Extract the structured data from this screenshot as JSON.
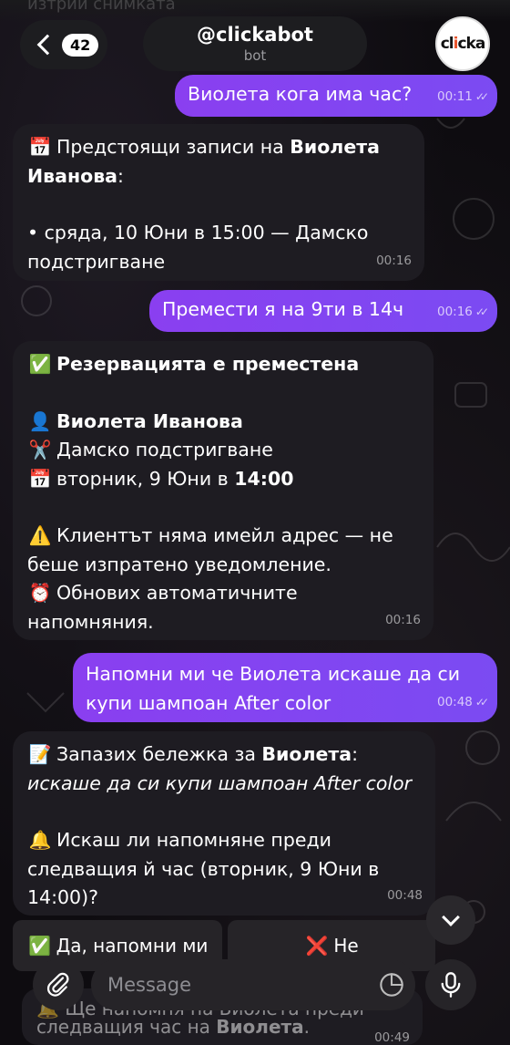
{
  "header": {
    "ghost_text": "изтрий снимката",
    "back_count": "42",
    "chat_name": "@clickabot",
    "chat_subtitle": "bot",
    "avatar_text_a": "cl",
    "avatar_text_b": "i",
    "avatar_text_c": "cka"
  },
  "messages": {
    "m1": {
      "text": "Виолета кога има час?",
      "time": "00:11"
    },
    "m2": {
      "emoji": "📅",
      "line1_pre": "Предстоящи записи на ",
      "line1_bold": "Виолета",
      "line2_bold": "Иванова",
      "line2_post": ":",
      "line3": "• сряда, 10 Юни в 15:00 — Дамско",
      "line4": "подстригване",
      "time": "00:16"
    },
    "m3": {
      "text": "Премести я на 9ти в 14ч",
      "time": "00:16"
    },
    "m4": {
      "emoji_check": "✅",
      "heading": "Резервацията е преместена",
      "emoji_person": "👤",
      "client": "Виолета Иванова",
      "emoji_scissors": "✂️",
      "service": "Дамско подстригване",
      "emoji_cal": "📅",
      "date_pre": "вторник, 9 Юни в ",
      "date_time": "14:00",
      "emoji_warn": "⚠️",
      "warn_line1": "Клиентът няма имейл адрес — не",
      "warn_line2": "беше изпратено уведомление.",
      "emoji_alarm": "⏰",
      "alarm_line1": "Обнових автоматичните",
      "alarm_line2": "напомняния.",
      "time": "00:16"
    },
    "m5": {
      "line1": "Напомни ми че Виолета искаше да си",
      "line2": "купи шампоан After color",
      "time": "00:48"
    },
    "m6": {
      "emoji_memo": "📝",
      "line1_pre": "Запазих бележка за ",
      "line1_bold": "Виолета",
      "line1_post": ":",
      "line2_italic": "искаше да си купи шампоан After color",
      "emoji_bell": "🔔",
      "line3": "Искаш ли напомняне преди",
      "line4": "следващия й час (вторник, 9 Юни в",
      "line5": "14:00)?",
      "time": "00:48"
    },
    "m7_partial": {
      "line1": "🔔 Ще напомня на Виолета преди",
      "line2_pre": "следващия час на ",
      "line2_bold": "Виолета",
      "line2_post": ".",
      "time": "00:49"
    }
  },
  "keyboard": {
    "yes_emoji": "✅",
    "yes_label": "Да, напомни ми",
    "no_emoji": "❌",
    "no_label": "Не"
  },
  "composer": {
    "placeholder": "Message"
  },
  "colors": {
    "outgoing": "#8a3ff0",
    "incoming": "#1e1c22",
    "background": "#0e0c10"
  }
}
